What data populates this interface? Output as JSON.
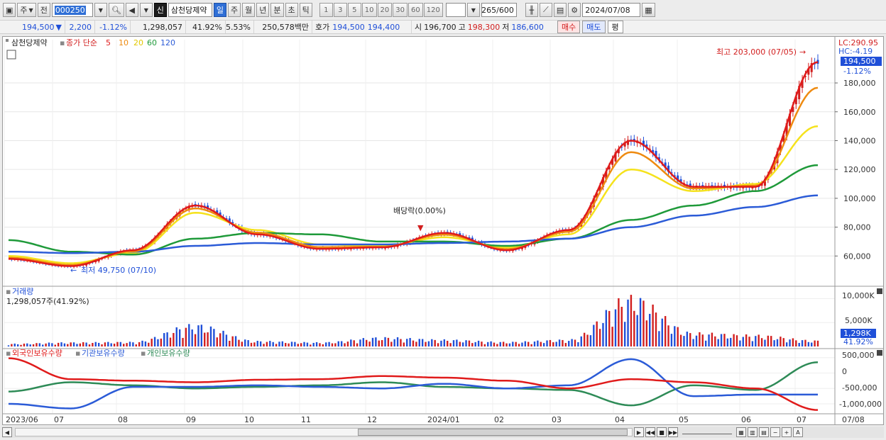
{
  "toolbar": {
    "market_label": "주",
    "prev_label": "전",
    "stock_code": "000250",
    "stock_name": "삼천당제약",
    "period_tabs": [
      {
        "label": "일",
        "selected": true
      },
      {
        "label": "주",
        "selected": false
      },
      {
        "label": "월",
        "selected": false
      },
      {
        "label": "년",
        "selected": false
      },
      {
        "label": "분",
        "selected": false
      },
      {
        "label": "초",
        "selected": false
      },
      {
        "label": "틱",
        "selected": false
      }
    ],
    "interval_buttons": [
      "1",
      "3",
      "5",
      "10",
      "20",
      "30",
      "60",
      "120"
    ],
    "count_value": "265",
    "count_max": "/600",
    "date_value": "2024/07/08",
    "badge": "신"
  },
  "quote": {
    "price": "194,500",
    "change": "2,200",
    "change_pct": "-1.12%",
    "volume": "1,298,057",
    "volume_ratio": "41.92%",
    "turnover_pct": "5.53%",
    "amount": "250,578백만",
    "bidask_label": "호가",
    "ask": "194,500",
    "bid": "194,400",
    "open_label": "시",
    "open": "196,700",
    "high_label": "고",
    "high": "198,300",
    "low_label": "저",
    "low": "186,600",
    "buy_label": "매수",
    "sell_label": "매도",
    "eval_label": "평"
  },
  "price_pane": {
    "stock_tag": "삼천당제약",
    "ma_prefix": "종가 단순",
    "ma_periods": [
      "5",
      "10",
      "20",
      "60",
      "120"
    ],
    "ma_colors": [
      "#e01b1b",
      "#ee8a10",
      "#f5e21c",
      "#1f9a3a",
      "#2b5bd7"
    ],
    "lc_label": "LC:290.95",
    "hc_label": "HC:-4.19",
    "current_price_tag": "194,500",
    "current_pct_tag": "-1.12%",
    "high_annotation": "최고 203,000 (07/05)",
    "low_annotation": "최저 49,750 (07/10)",
    "dividend_annotation": "배당락(0.00%)",
    "y_ticks": [
      "180,000",
      "160,000",
      "140,000",
      "120,000",
      "100,000",
      "80,000",
      "60,000"
    ]
  },
  "volume_pane": {
    "title": "거래량",
    "value": "1,298,057주(41.92%)",
    "y_ticks": [
      "10,000K",
      "5,000K"
    ],
    "current_tag": "1,298K",
    "current_pct": "41.92%"
  },
  "holdings_pane": {
    "series": [
      {
        "name": "외국인보유수량",
        "color": "#e01b1b"
      },
      {
        "name": "기관보유수량",
        "color": "#2b5bd7"
      },
      {
        "name": "개인보유수량",
        "color": "#2e8b57"
      }
    ],
    "y_ticks": [
      "500,000",
      "0",
      "-500,000",
      "-1,000,000"
    ]
  },
  "x_axis": {
    "labels": [
      "2023/06",
      "07",
      "08",
      "09",
      "10",
      "11",
      "12",
      "2024/01",
      "02",
      "03",
      "04",
      "05",
      "06",
      "07",
      "07/08"
    ]
  },
  "chart_data": {
    "type": "line",
    "title": "",
    "stock": "삼천당제약",
    "x": [
      "2023/06",
      "07",
      "08",
      "09",
      "10",
      "11",
      "12",
      "2024/01",
      "02",
      "03",
      "04",
      "05",
      "06",
      "07"
    ],
    "ylim": [
      50000,
      205000
    ],
    "series": [
      {
        "name": "종가",
        "values": [
          58000,
          53000,
          64000,
          95000,
          75000,
          65000,
          66000,
          76000,
          64000,
          78000,
          140000,
          108000,
          108000,
          194500
        ]
      },
      {
        "name": "20",
        "values": [
          60000,
          55000,
          62000,
          90000,
          78000,
          68000,
          67000,
          73000,
          66000,
          75000,
          120000,
          105000,
          110000,
          150000
        ]
      },
      {
        "name": "60",
        "values": [
          71000,
          63000,
          61000,
          72000,
          76000,
          75000,
          70000,
          70000,
          67000,
          72000,
          85000,
          95000,
          105000,
          123000
        ]
      },
      {
        "name": "120",
        "values": [
          63000,
          62000,
          63000,
          67000,
          69000,
          68000,
          68000,
          69000,
          70000,
          72000,
          80000,
          88000,
          94000,
          102000
        ]
      }
    ],
    "volume_values_k": [
      600,
      900,
      1000,
      4800,
      1200,
      900,
      2000,
      1500,
      1000,
      1500,
      11000,
      3000,
      2500,
      1298
    ],
    "holdings": {
      "외국인보유수량": [
        480000,
        -200000,
        -250000,
        -300000,
        -220000,
        -200000,
        -100000,
        -150000,
        -250000,
        -500000,
        -200000,
        -300000,
        -500000,
        -1200000
      ],
      "기관보유수량": [
        -1000000,
        -1150000,
        -450000,
        -450000,
        -400000,
        -450000,
        -500000,
        -350000,
        -500000,
        -400000,
        450000,
        -750000,
        -700000,
        -700000
      ],
      "개인보유수량": [
        -600000,
        -300000,
        -400000,
        -500000,
        -450000,
        -400000,
        -300000,
        -450000,
        -500000,
        -550000,
        -1050000,
        -400000,
        -550000,
        350000
      ]
    }
  }
}
